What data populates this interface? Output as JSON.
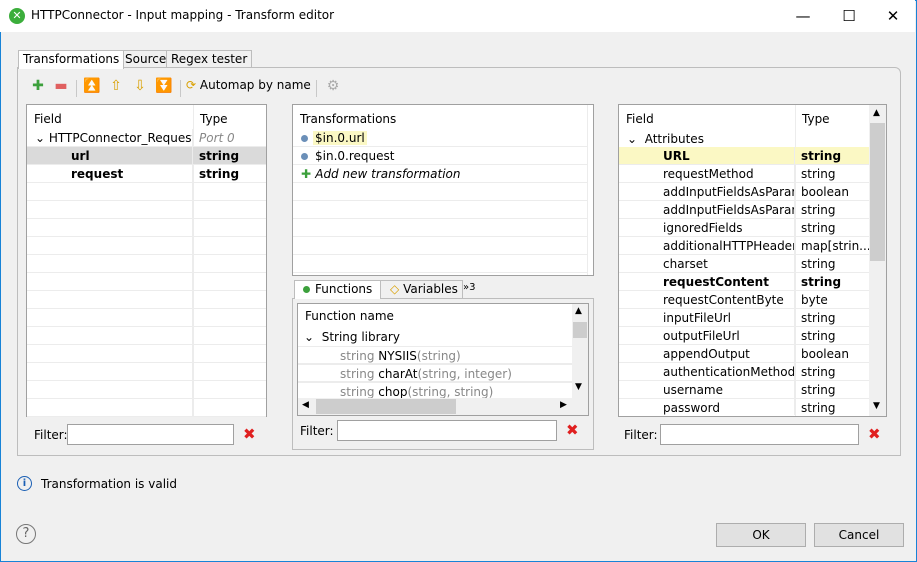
{
  "window": {
    "title": "HTTPConnector - Input mapping - Transform editor",
    "minimize": "—",
    "maximize": "☐",
    "close": "✕"
  },
  "tabs": [
    "Transformations",
    "Source",
    "Regex tester"
  ],
  "toolbar": {
    "automap_label": "Automap by name"
  },
  "left": {
    "header_field": "Field",
    "header_type": "Type",
    "rows": [
      {
        "field": "HTTPConnector_Request",
        "type": "Port 0",
        "level": 0,
        "kind": "group"
      },
      {
        "field": "url",
        "type": "string",
        "level": 1,
        "kind": "bold",
        "selected": true
      },
      {
        "field": "request",
        "type": "string",
        "level": 1,
        "kind": "bold"
      }
    ]
  },
  "middle": {
    "header": "Transformations",
    "rows": [
      "$in.0.url",
      "$in.0.request"
    ],
    "add_new": "Add new transformation"
  },
  "functions": {
    "tabs": [
      "Functions",
      "Variables",
      "»3"
    ],
    "header": "Function name",
    "group": "String library",
    "items": [
      {
        "ret": "string",
        "name": "NYSIIS",
        "args": "(string)"
      },
      {
        "ret": "string",
        "name": "charAt",
        "args": "(string, integer)"
      },
      {
        "ret": "string",
        "name": "chop",
        "args": "(string, string)"
      }
    ]
  },
  "right": {
    "header_field": "Field",
    "header_type": "Type",
    "group": "Attributes",
    "rows": [
      {
        "field": "URL",
        "type": "string",
        "bold": true,
        "hl": true
      },
      {
        "field": "requestMethod",
        "type": "string"
      },
      {
        "field": "addInputFieldsAsParame",
        "type": "boolean"
      },
      {
        "field": "addInputFieldsAsParame",
        "type": "string"
      },
      {
        "field": "ignoredFields",
        "type": "string"
      },
      {
        "field": "additionalHTTPHeaders",
        "type": "map[strin..."
      },
      {
        "field": "charset",
        "type": "string"
      },
      {
        "field": "requestContent",
        "type": "string",
        "bold": true
      },
      {
        "field": "requestContentByte",
        "type": "byte"
      },
      {
        "field": "inputFileUrl",
        "type": "string"
      },
      {
        "field": "outputFileUrl",
        "type": "string"
      },
      {
        "field": "appendOutput",
        "type": "boolean"
      },
      {
        "field": "authenticationMethod",
        "type": "string"
      },
      {
        "field": "username",
        "type": "string"
      },
      {
        "field": "password",
        "type": "string"
      }
    ]
  },
  "filter": {
    "label": "Filter:",
    "value": ""
  },
  "status": {
    "text": "Transformation is valid"
  },
  "buttons": {
    "ok": "OK",
    "cancel": "Cancel",
    "help": "?"
  },
  "colors": {
    "highlight": "#fbf8c4",
    "selection": "#dadada",
    "accent": "#1883d7",
    "clear": "#e02020"
  }
}
